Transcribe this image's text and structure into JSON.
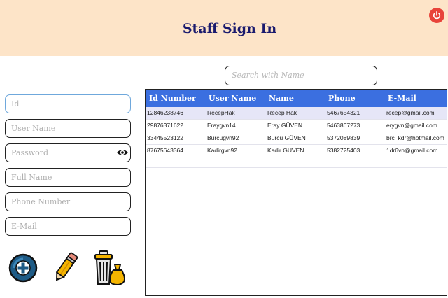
{
  "header": {
    "title": "Staff Sign In"
  },
  "search": {
    "placeholder": "Search with Name"
  },
  "form": {
    "id_placeholder": "Id",
    "username_placeholder": "User Name",
    "password_placeholder": "Password",
    "fullname_placeholder": "Full Name",
    "phone_placeholder": "Phone Number",
    "email_placeholder": "E-Mail"
  },
  "table": {
    "columns": [
      "Id Number",
      "User Name",
      "Name",
      "Phone",
      "E-Mail"
    ],
    "rows": [
      [
        "12846238746",
        "RecepHak",
        "Recep Hak",
        "5467654321",
        "recep@gmail.com"
      ],
      [
        "29876371622",
        "Eraygvn14",
        "Eray GÜVEN",
        "5463867273",
        "erygvn@gmail.com"
      ],
      [
        "33445523122",
        "Burcugvn92",
        "Burcu GÜVEN",
        "5372089839",
        "brc_kdr@hotmail.com"
      ],
      [
        "87675643364",
        "Kadirgvn92",
        "Kadir GÜVEN",
        "5382725403",
        "1dr6vn@gmail.com"
      ]
    ]
  },
  "icons": {
    "power": "power-icon",
    "eye": "eye-icon",
    "add": "add-icon",
    "edit": "pencil-icon",
    "delete": "trash-icon"
  },
  "colors": {
    "header_bg": "#fde4c8",
    "title": "#1a1a6e",
    "table_header": "#3b6fe0",
    "selected_row": "#e6e6f7",
    "power_button": "#e8433a"
  }
}
